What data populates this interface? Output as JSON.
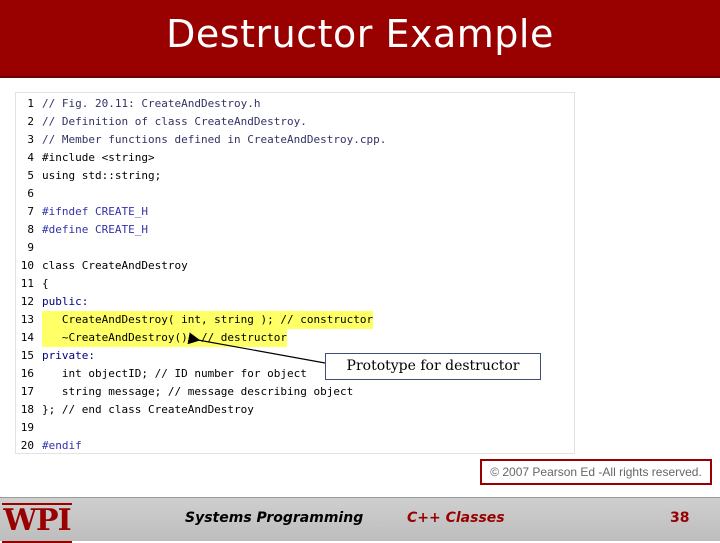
{
  "slide": {
    "title": "Destructor Example",
    "callout": "Prototype for destructor",
    "copyright": "© 2007 Pearson Ed -All rights reserved.",
    "footer_left": "Systems Programming",
    "footer_mid": "C++ Classes",
    "page": "38",
    "logo": "WPI"
  },
  "code": [
    {
      "n": "1",
      "t": "// Fig. 20.11: CreateAndDestroy.h",
      "cls": "c-comment"
    },
    {
      "n": "2",
      "t": "// Definition of class CreateAndDestroy.",
      "cls": "c-comment"
    },
    {
      "n": "3",
      "t": "// Member functions defined in CreateAndDestroy.cpp.",
      "cls": "c-comment"
    },
    {
      "n": "4",
      "t": "#include <string>",
      "cls": "c-plain"
    },
    {
      "n": "5",
      "t": "using std::string;",
      "cls": "c-plain"
    },
    {
      "n": "6",
      "t": "",
      "cls": "c-plain"
    },
    {
      "n": "7",
      "t": "#ifndef CREATE_H",
      "cls": "c-macro"
    },
    {
      "n": "8",
      "t": "#define CREATE_H",
      "cls": "c-macro"
    },
    {
      "n": "9",
      "t": "",
      "cls": "c-plain"
    },
    {
      "n": "10",
      "t": "class CreateAndDestroy",
      "cls": "c-plain"
    },
    {
      "n": "11",
      "t": "{",
      "cls": "c-plain"
    },
    {
      "n": "12",
      "t": "public:",
      "cls": "c-kw"
    },
    {
      "n": "13",
      "t": "   CreateAndDestroy( int, string ); // constructor",
      "cls": "c-plain"
    },
    {
      "n": "14",
      "t": "   ~CreateAndDestroy(); // destructor",
      "cls": "c-plain"
    },
    {
      "n": "15",
      "t": "private:",
      "cls": "c-kw"
    },
    {
      "n": "16",
      "t": "   int objectID; // ID number for object",
      "cls": "c-plain"
    },
    {
      "n": "17",
      "t": "   string message; // message describing object",
      "cls": "c-plain"
    },
    {
      "n": "18",
      "t": "}; // end class CreateAndDestroy",
      "cls": "c-plain"
    },
    {
      "n": "19",
      "t": "",
      "cls": "c-plain"
    },
    {
      "n": "20",
      "t": "#endif",
      "cls": "c-macro"
    }
  ]
}
